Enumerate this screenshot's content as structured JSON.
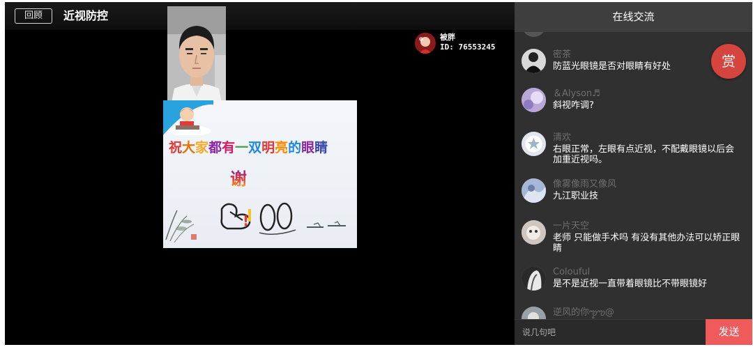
{
  "topbar": {
    "back_label": "回顾",
    "title": "近视防控"
  },
  "host": {
    "name": "被胖",
    "id_text": "ID: 76553245"
  },
  "slide": {
    "headline_chars": [
      {
        "char": "祝",
        "color": "#e53935"
      },
      {
        "char": "大",
        "color": "#ef6c00"
      },
      {
        "char": "家",
        "color": "#f9a825"
      },
      {
        "char": "都",
        "color": "#8e24aa"
      },
      {
        "char": "有",
        "color": "#d81b60"
      },
      {
        "char": "一",
        "color": "#43a047"
      },
      {
        "char": "双",
        "color": "#1e88e5"
      },
      {
        "char": "明",
        "color": "#e53935"
      },
      {
        "char": "亮",
        "color": "#fb8c00"
      },
      {
        "char": "的",
        "color": "#1e88e5"
      },
      {
        "char": "眼",
        "color": "#8e24aa"
      },
      {
        "char": "睛",
        "color": "#3949ab"
      }
    ],
    "thanks": "谢"
  },
  "chat": {
    "title": "在线交流",
    "messages": [
      {
        "user": "",
        "text": ""
      },
      {
        "user": "密茶",
        "text": "防蓝光眼镜是否对眼睛有好处"
      },
      {
        "user": "＆Alyson♬",
        "text": "斜视咋调?"
      },
      {
        "user": "清欢",
        "text": "右眼正常，左眼有点近视，不配戴眼镜以后会加重近视吗。"
      },
      {
        "user": "像雾像雨又像风",
        "text": "九江职业技"
      },
      {
        "user": "一片天空",
        "text": "老师 只能做手术吗 有没有其他办法可以矫正眼睛"
      },
      {
        "user": "Colouful",
        "text": "是不是近视一直带着眼镜比不带眼镜好"
      },
      {
        "user": "逆风的你ఌ఼ఌ@",
        "text": ""
      }
    ],
    "reward_label": "赏",
    "input_placeholder": "说几句吧",
    "send_label": "发送"
  }
}
